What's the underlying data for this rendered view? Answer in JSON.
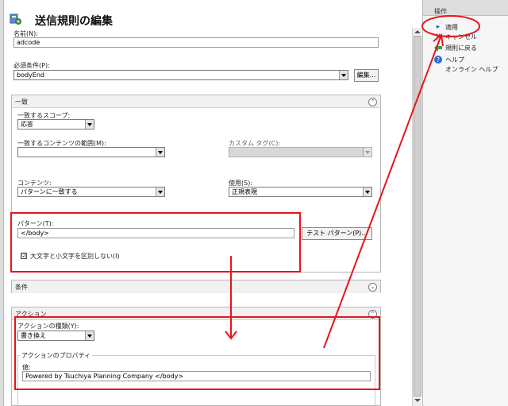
{
  "title": "送信規則の編集",
  "name": {
    "label": "名前(N):",
    "value": "adcode"
  },
  "precondition": {
    "label": "必須条件(P):",
    "value": "bodyEnd",
    "edit_button": "編集..."
  },
  "match_section": {
    "title": "一致",
    "scope_label": "一致するスコープ:",
    "scope_value": "応答",
    "content_range_label": "一致するコンテンツの範囲(M):",
    "content_range_value": "",
    "custom_tag_label": "カスタム タグ(C):",
    "custom_tag_value": "",
    "content_label": "コンテンツ:",
    "content_value": "パターンに一致する",
    "using_label": "使用(S):",
    "using_value": "正規表現",
    "pattern_label": "パターン(T):",
    "pattern_value": "</body>",
    "test_pattern_button": "テスト パターン(P)...",
    "ignore_case_label": "大文字と小文字を区別しない(I)",
    "ignore_case_checked": "☑"
  },
  "conditions_section": {
    "title": "条件"
  },
  "action_section": {
    "title": "アクション",
    "type_label": "アクションの種類(Y):",
    "type_value": "書き換え",
    "properties_legend": "アクションのプロパティ",
    "value_label": "値:",
    "value_value": "Powered by Tsuchiya Planning Company </body>"
  },
  "actions_pane": {
    "header": "操作",
    "apply": "適用",
    "cancel": "キャンセル",
    "back_to_rules": "規則に戻る",
    "help": "ヘルプ",
    "online_help": "オンライン ヘルプ"
  },
  "colors": {
    "annotation_red": "#e8141c",
    "collapse_glyph": "⌃"
  }
}
